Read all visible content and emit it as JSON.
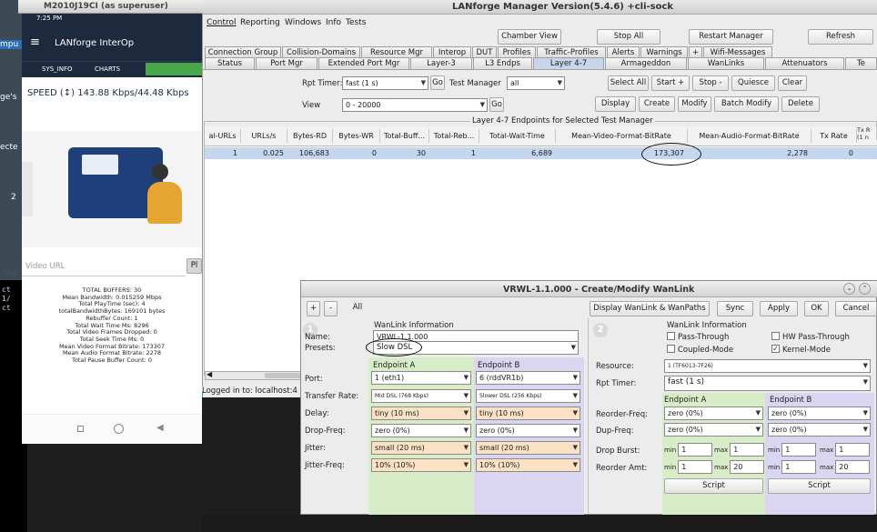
{
  "phone_titlebar": {
    "title": "M2010J19CI (as superuser)"
  },
  "phone": {
    "status_time": "7:25 PM",
    "app_title": "LANforge InterOp",
    "tabs": [
      "SYS_INFO",
      "CHARTS"
    ],
    "speed_text": "SPEED (↕)   143.88 Kbps/44.48 Kbps",
    "video_url_placeholder": "Video URL",
    "play_label": "Pl",
    "stats": [
      "TOTAL BUFFERS: 30",
      "Mean Bandwidth: 0.015259 Mbps",
      "Total PlayTime (sec): 4",
      "totalBandwidthBytes: 169101 bytes",
      "Rebuffer Count: 1",
      "Total Wait Time Ms: 8296",
      "Total Video Frames Dropped: 0",
      "Total Seek Time Ms: 0",
      "Mean Video Format Bitrate: 173307",
      "Mean Audio Format Bitrate: 2278",
      "Total Pause Buffer Count: 0"
    ]
  },
  "left_strip": {
    "labels": [
      "mpu",
      "ge's",
      "ecte",
      "2",
      "Vie"
    ],
    "term": [
      "ct",
      "1/",
      "ct"
    ]
  },
  "manager": {
    "title": "LANforge Manager   Version(5.4.6)   +cli-sock",
    "menu": [
      "Control",
      "Reporting",
      "Windows",
      "Info",
      "Tests"
    ],
    "top_buttons": {
      "chamber": "Chamber View",
      "stop_all": "Stop All",
      "restart": "Restart Manager",
      "refresh": "Refresh"
    },
    "tabs_row1": [
      "Connection Group",
      "Collision-Domains",
      "Resource Mgr",
      "Interop",
      "DUT",
      "Profiles",
      "Traffic-Profiles",
      "Alerts",
      "Warnings",
      "+",
      "Wifi-Messages"
    ],
    "tabs_row2": [
      "Status",
      "Port Mgr",
      "Extended Port Mgr",
      "Layer-3",
      "L3 Endps",
      "Layer 4-7",
      "Armageddon",
      "WanLinks",
      "Attenuators",
      "Te"
    ],
    "rpt_timer_label": "Rpt Timer:",
    "rpt_timer_value": "fast     (1 s)",
    "go1": "Go",
    "test_manager_label": "Test Manager",
    "test_manager_value": "all",
    "view_label": "View",
    "view_value": "0 - 20000",
    "go2": "Go",
    "action_buttons_row1": [
      "Select All",
      "Start +",
      "Stop -",
      "Quiesce",
      "Clear"
    ],
    "action_buttons_row2": [
      "Display",
      "Create",
      "Modify",
      "Batch Modify",
      "Delete"
    ],
    "table_title": "Layer 4-7 Endpoints for Selected Test Manager",
    "columns": [
      "al-URLs",
      "URLs/s",
      "Bytes-RD",
      "Bytes-WR",
      "Total-Buff...",
      "Total-Reb...",
      "Total-Wait-Time",
      "Mean-Video-Format-BitRate",
      "Mean-Audio-Format-BitRate",
      "Tx Rate",
      "Tx R (1 n"
    ],
    "row": [
      "1",
      "0.025",
      "106,683",
      "0",
      "30",
      "1",
      "6,689",
      "173,307",
      "2,278",
      "0",
      ""
    ],
    "status_text": "Logged in to:  localhost:4"
  },
  "wanlink": {
    "title": "VRWL-1.1.000 - Create/Modify WanLink",
    "toolbar": {
      "plus": "+",
      "minus": "-",
      "all": "All",
      "display": "Display WanLink & WanPaths",
      "sync": "Sync",
      "apply": "Apply",
      "ok": "OK",
      "cancel": "Cancel"
    },
    "left": {
      "section_title": "WanLink Information",
      "name_label": "Name:",
      "name_value": "VRWL-1.1.000",
      "presets_label": "Presets:",
      "presets_value": "Slow DSL",
      "endpoint_a": "Endpoint A",
      "endpoint_b": "Endpoint B",
      "rows": [
        {
          "label": "Port:",
          "a": "1 (eth1)",
          "b": "6 (rddVR1b)"
        },
        {
          "label": "Transfer Rate:",
          "a": "Mid DSL      (768 Kbps)",
          "b": "Slower DSL (256 Kbps)"
        },
        {
          "label": "Delay:",
          "a": "tiny (10 ms)",
          "b": "tiny (10 ms)"
        },
        {
          "label": "Drop-Freq:",
          "a": "zero (0%)",
          "b": "zero (0%)"
        },
        {
          "label": "Jitter:",
          "a": "small (20 ms)",
          "b": "small (20 ms)"
        },
        {
          "label": "Jitter-Freq:",
          "a": "10% (10%)",
          "b": "10% (10%)"
        }
      ]
    },
    "right": {
      "section_title": "WanLink Information",
      "pass_through": "Pass-Through",
      "hw_pass_through": "HW Pass-Through",
      "coupled_mode": "Coupled-Mode",
      "kernel_mode": "Kernel-Mode",
      "resource_label": "Resource:",
      "resource_value": "1 (TF6013-7F26)",
      "rpt_timer_label": "Rpt Timer:",
      "rpt_timer_value": "fast     (1 s)",
      "endpoint_a": "Endpoint A",
      "endpoint_b": "Endpoint B",
      "reorder_freq_label": "Reorder-Freq:",
      "dup_freq_label": "Dup-Freq:",
      "drop_burst_label": "Drop Burst:",
      "reorder_amt_label": "Reorder Amt:",
      "reorder_a": "zero (0%)",
      "reorder_b": "zero (0%)",
      "dup_a": "zero (0%)",
      "dup_b": "zero (0%)",
      "min_label": "min",
      "max_label": "max",
      "burst": [
        "1",
        "1",
        "1",
        "1"
      ],
      "amt": [
        "1",
        "20",
        "1",
        "20"
      ],
      "script_a": "Script",
      "script_b": "Script"
    }
  }
}
